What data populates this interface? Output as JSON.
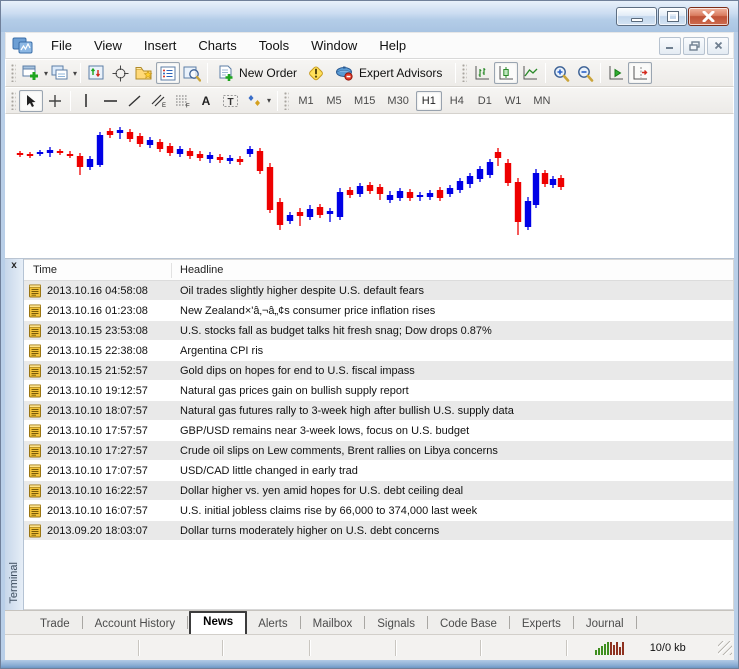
{
  "window": {
    "title": ""
  },
  "menu": {
    "items": [
      "File",
      "View",
      "Insert",
      "Charts",
      "Tools",
      "Window",
      "Help"
    ]
  },
  "toolbar": {
    "new_order_label": "New Order",
    "expert_advisors_label": "Expert Advisors"
  },
  "drawing_tools": {
    "text_tool": "A",
    "label_tool": "T",
    "channel_sub": "E",
    "fibo_sub": "F"
  },
  "timeframes": {
    "items": [
      "M1",
      "M5",
      "M15",
      "M30",
      "H1",
      "H4",
      "D1",
      "W1",
      "MN"
    ],
    "active": "H1"
  },
  "chart_data": {
    "type": "candlestick",
    "timeframe": "H1",
    "background": "#ffffff",
    "bull_color": "#0000e6",
    "bear_color": "#ee0000",
    "axes_visible": false,
    "note": "values are pixel positions [xCenter, dir(b=bull/r=bear), highY, bodyTopY, bodyBottomY, lowY] since no price axis is shown",
    "candles": [
      [
        15,
        "r",
        37,
        39,
        41,
        43
      ],
      [
        25,
        "r",
        38,
        40,
        42,
        44
      ],
      [
        35,
        "b",
        36,
        38,
        40,
        42
      ],
      [
        45,
        "b",
        33,
        36,
        39,
        43
      ],
      [
        55,
        "r",
        35,
        37,
        39,
        41
      ],
      [
        65,
        "r",
        37,
        40,
        42,
        44
      ],
      [
        75,
        "r",
        39,
        42,
        53,
        61
      ],
      [
        85,
        "b",
        42,
        45,
        53,
        56
      ],
      [
        95,
        "b",
        18,
        21,
        51,
        53
      ],
      [
        105,
        "r",
        14,
        17,
        21,
        24
      ],
      [
        115,
        "b",
        13,
        16,
        19,
        25
      ],
      [
        125,
        "r",
        15,
        18,
        25,
        28
      ],
      [
        135,
        "r",
        19,
        22,
        30,
        33
      ],
      [
        145,
        "b",
        23,
        26,
        31,
        34
      ],
      [
        155,
        "r",
        25,
        28,
        35,
        38
      ],
      [
        165,
        "r",
        29,
        32,
        39,
        42
      ],
      [
        175,
        "b",
        32,
        35,
        40,
        43
      ],
      [
        185,
        "r",
        34,
        37,
        42,
        45
      ],
      [
        195,
        "r",
        37,
        40,
        44,
        47
      ],
      [
        205,
        "b",
        38,
        41,
        45,
        49
      ],
      [
        215,
        "r",
        40,
        43,
        46,
        49
      ],
      [
        225,
        "b",
        41,
        44,
        47,
        50
      ],
      [
        235,
        "r",
        42,
        45,
        48,
        51
      ],
      [
        245,
        "b",
        32,
        35,
        40,
        43
      ],
      [
        255,
        "r",
        34,
        37,
        57,
        60
      ],
      [
        265,
        "r",
        49,
        53,
        96,
        99
      ],
      [
        275,
        "r",
        84,
        88,
        111,
        116
      ],
      [
        285,
        "b",
        98,
        101,
        107,
        110
      ],
      [
        295,
        "r",
        94,
        98,
        102,
        112
      ],
      [
        305,
        "b",
        91,
        95,
        103,
        106
      ],
      [
        315,
        "r",
        90,
        93,
        101,
        104
      ],
      [
        325,
        "b",
        94,
        97,
        100,
        108
      ],
      [
        335,
        "b",
        74,
        78,
        103,
        106
      ],
      [
        345,
        "r",
        73,
        76,
        81,
        84
      ],
      [
        355,
        "b",
        69,
        72,
        80,
        83
      ],
      [
        365,
        "r",
        68,
        71,
        77,
        80
      ],
      [
        375,
        "r",
        70,
        73,
        80,
        86
      ],
      [
        385,
        "b",
        77,
        81,
        86,
        89
      ],
      [
        395,
        "b",
        74,
        77,
        84,
        87
      ],
      [
        405,
        "r",
        75,
        78,
        84,
        87
      ],
      [
        415,
        "b",
        78,
        81,
        83,
        87
      ],
      [
        425,
        "b",
        76,
        79,
        83,
        86
      ],
      [
        435,
        "r",
        73,
        76,
        84,
        87
      ],
      [
        445,
        "b",
        71,
        74,
        80,
        83
      ],
      [
        455,
        "b",
        64,
        67,
        76,
        79
      ],
      [
        465,
        "b",
        59,
        62,
        70,
        74
      ],
      [
        475,
        "b",
        52,
        55,
        65,
        68
      ],
      [
        485,
        "b",
        45,
        48,
        61,
        64
      ],
      [
        493,
        "r",
        34,
        38,
        44,
        52
      ],
      [
        503,
        "r",
        45,
        49,
        69,
        72
      ],
      [
        513,
        "r",
        64,
        68,
        108,
        121
      ],
      [
        523,
        "b",
        83,
        87,
        113,
        116
      ],
      [
        531,
        "b",
        55,
        59,
        91,
        94
      ],
      [
        540,
        "r",
        56,
        59,
        70,
        73
      ],
      [
        548,
        "b",
        62,
        65,
        71,
        74
      ],
      [
        556,
        "r",
        61,
        64,
        73,
        76
      ]
    ]
  },
  "news_panel": {
    "close_label": "x",
    "columns": [
      "Time",
      "Headline"
    ],
    "rows": [
      {
        "time": "2013.10.16 04:58:08",
        "headline": "Oil trades slightly higher despite U.S. default fears"
      },
      {
        "time": "2013.10.16 01:23:08",
        "headline": "New Zealand×'â‚¬â„¢s consumer price inflation rises"
      },
      {
        "time": "2013.10.15 23:53:08",
        "headline": "U.S. stocks fall as budget talks hit fresh snag; Dow drops 0.87%"
      },
      {
        "time": "2013.10.15 22:38:08",
        "headline": "Argentina CPI ris"
      },
      {
        "time": "2013.10.15 21:52:57",
        "headline": "Gold dips on hopes for end to U.S. fiscal impass"
      },
      {
        "time": "2013.10.10 19:12:57",
        "headline": "Natural gas prices gain on bullish supply report"
      },
      {
        "time": "2013.10.10 18:07:57",
        "headline": "Natural gas futures rally to 3-week high after bullish U.S. supply data"
      },
      {
        "time": "2013.10.10 17:57:57",
        "headline": "GBP/USD remains near 3-week lows, focus on U.S. budget"
      },
      {
        "time": "2013.10.10 17:27:57",
        "headline": "Crude oil slips on Lew comments, Brent rallies on Libya concerns"
      },
      {
        "time": "2013.10.10 17:07:57",
        "headline": "USD/CAD little changed in early trad"
      },
      {
        "time": "2013.10.10 16:22:57",
        "headline": "Dollar higher vs. yen amid hopes for U.S. debt ceiling deal"
      },
      {
        "time": "2013.10.10 16:07:57",
        "headline": "U.S. initial jobless claims rise by 66,000 to 374,000 last week"
      },
      {
        "time": "2013.09.20 18:03:07",
        "headline": "Dollar turns moderately higher on U.S. debt concerns"
      }
    ]
  },
  "terminal": {
    "label": "Terminal"
  },
  "tabs": {
    "items": [
      "Trade",
      "Account History",
      "News",
      "Alerts",
      "Mailbox",
      "Signals",
      "Code Base",
      "Experts",
      "Journal"
    ],
    "active": "News"
  },
  "status_bar": {
    "traffic": "10/0 kb"
  }
}
